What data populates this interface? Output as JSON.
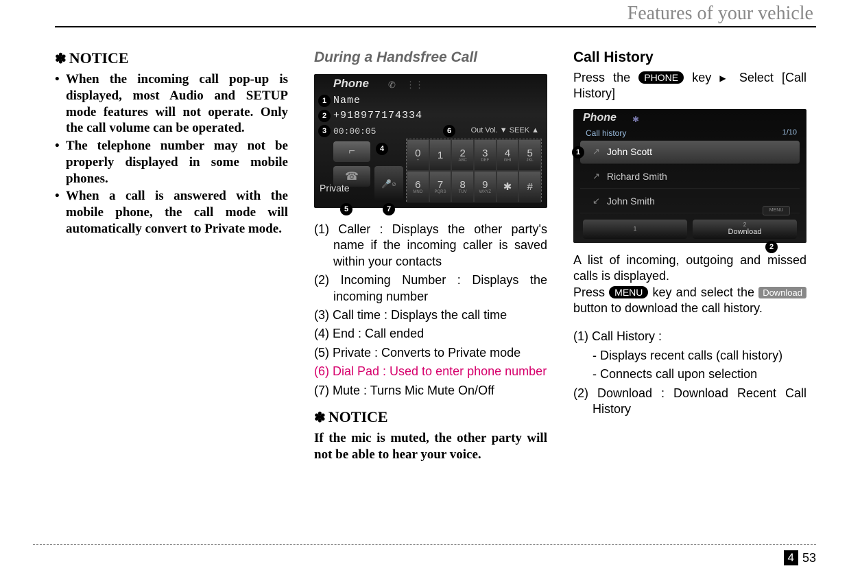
{
  "header": {
    "title": "Features of your vehicle"
  },
  "col1": {
    "notice_head": "NOTICE",
    "items": [
      "When the incoming call pop-up is displayed, most Audio and SETUP mode features will not operate. Only the call volume can be operated.",
      "The telephone number may not be properly displayed in some mobile phones.",
      "When a call is answered with the mobile phone, the call mode will automatically convert to Private mode."
    ]
  },
  "col2": {
    "heading": "During a Handsfree Call",
    "phone": {
      "title": "Phone",
      "name": "Name",
      "number": "+918977174334",
      "time": "00:00:05",
      "outvol": "Out Vol. ▼ SEEK ▲",
      "private_label": "Private",
      "keys_top": [
        {
          "n": "0",
          "s": "+"
        },
        {
          "n": "1",
          "s": ""
        },
        {
          "n": "2",
          "s": "ABC"
        },
        {
          "n": "3",
          "s": "DEF"
        },
        {
          "n": "4",
          "s": "GHI"
        },
        {
          "n": "5",
          "s": "JKL"
        }
      ],
      "keys_bot": [
        {
          "n": "6",
          "s": "MNO"
        },
        {
          "n": "7",
          "s": "PQRS"
        },
        {
          "n": "8",
          "s": "TUV"
        },
        {
          "n": "9",
          "s": "WXYZ"
        },
        {
          "n": "✱",
          "s": ""
        },
        {
          "n": "#",
          "s": ""
        }
      ]
    },
    "list": {
      "i1": "(1) Caller : Displays the other party's name if the incoming caller is saved within your contacts",
      "i2": "(2) Incoming Number : Displays the incoming number",
      "i3": "(3) Call time : Displays the call time",
      "i4": "(4) End : Call ended",
      "i5": "(5) Private : Converts to Private mode",
      "i6": "(6) Dial Pad : Used to enter phone number",
      "i7": "(7) Mute : Turns Mic Mute On/Off"
    },
    "notice_head": "NOTICE",
    "notice_body": "If the mic is muted, the other party will not be able to hear your voice."
  },
  "col3": {
    "heading": "Call History",
    "intro_a": "Press the ",
    "intro_key": "PHONE",
    "intro_b": " key ",
    "intro_c": " Select [Call History]",
    "hist": {
      "title": "Phone",
      "sub": "Call history",
      "count": "1/10",
      "rows": [
        "John Scott",
        "Richard Smith",
        "John Smith"
      ],
      "soft1_n": "1",
      "soft1_l": "",
      "soft2_n": "2",
      "soft2_l": "Download",
      "menu": "MENU"
    },
    "p1": "A list of incoming, outgoing and missed calls is displayed.",
    "p2a": "Press ",
    "p2_key": "MENU",
    "p2b": " key and select the ",
    "p2_dl": "Download",
    "p2c": " button to download the call history.",
    "l1": "(1) Call History :",
    "l1a": "- Displays recent calls (call history)",
    "l1b": "- Connects call upon selection",
    "l2": "(2) Download : Download Recent Call History"
  },
  "footer": {
    "chapter": "4",
    "page": "53"
  }
}
